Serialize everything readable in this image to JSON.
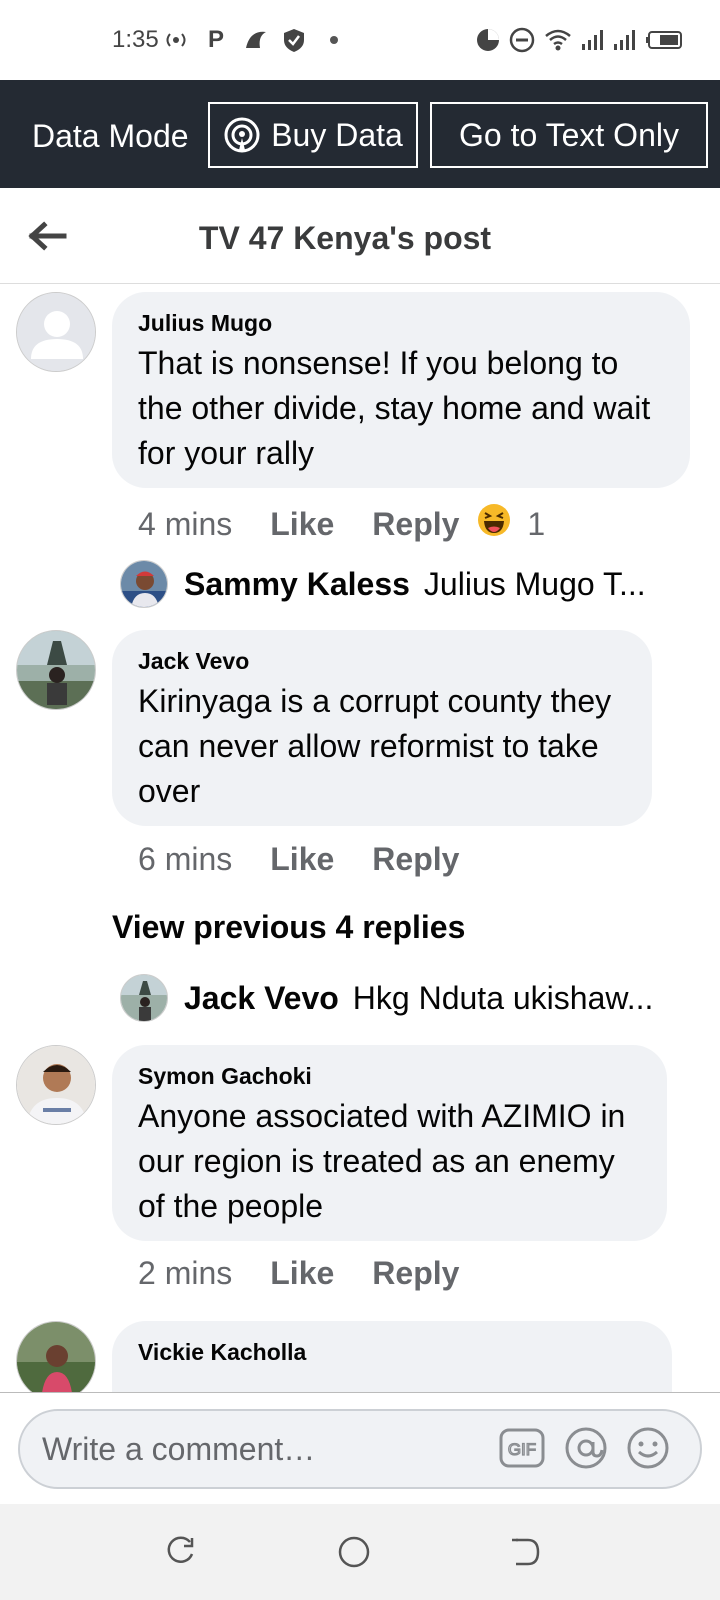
{
  "status_bar": {
    "time": "1:35",
    "icons": [
      "radio-icon",
      "parking-icon",
      "shark-icon",
      "shield-icon",
      "dot-icon",
      "data-saver-icon",
      "dnd-icon",
      "wifi-icon",
      "signal-icon",
      "signal-icon-2",
      "battery-icon"
    ]
  },
  "data_banner": {
    "label": "Data Mode",
    "buy_data": "Buy Data",
    "text_only": "Go to Text Only"
  },
  "header": {
    "title": "TV 47 Kenya's post",
    "back_icon": "back-arrow-icon"
  },
  "comments": [
    {
      "author": "Julius Mugo",
      "text": "That is nonsense!  If you belong to the other divide, stay home and wait for your rally",
      "time": "4 mins",
      "like": "Like",
      "reply": "Reply",
      "reaction_icon": "haha-icon",
      "reaction_count": "1",
      "reply_preview": {
        "name": "Sammy Kaless",
        "text": "Julius Mugo T..."
      }
    },
    {
      "author": "Jack Vevo",
      "text": "Kirinyaga is a corrupt county they can never allow reformist to take over",
      "time": "6 mins",
      "like": "Like",
      "reply": "Reply",
      "view_previous": "View previous 4 replies",
      "reply_preview": {
        "name": "Jack Vevo",
        "text": "Hkg Nduta ukishaw..."
      }
    },
    {
      "author": "Symon Gachoki",
      "text": "Anyone associated with AZIMIO in our region is treated as an enemy of the people",
      "time": "2 mins",
      "like": "Like",
      "reply": "Reply"
    },
    {
      "author": "Vickie Kacholla"
    }
  ],
  "composer": {
    "placeholder": "Write a comment…",
    "gif": "GIF",
    "icons": [
      "gif-icon",
      "mention-icon",
      "emoji-icon"
    ]
  },
  "nav_bar": {
    "icons": [
      "recents-icon",
      "home-icon",
      "back-icon"
    ]
  },
  "colors": {
    "banner_bg": "#242a33",
    "bubble_bg": "#f0f2f5",
    "meta_text": "#65676b"
  }
}
